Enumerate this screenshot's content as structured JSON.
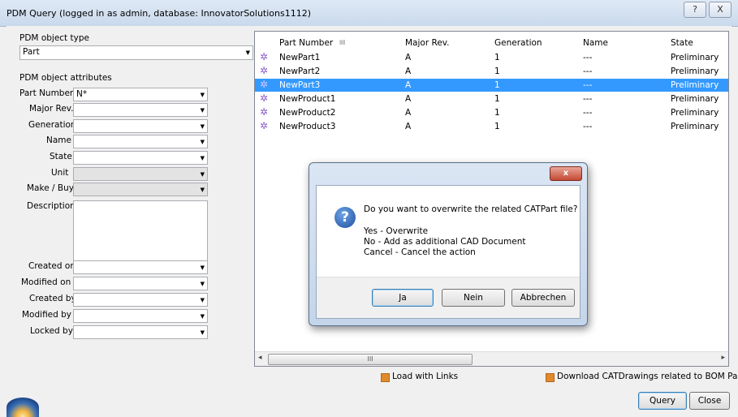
{
  "window": {
    "title": "PDM Query (logged in as admin, database: InnovatorSolutions1112)",
    "help_label": "?",
    "close_label": "X"
  },
  "left": {
    "object_type_label": "PDM object type",
    "object_type_value": "Part",
    "attributes_label": "PDM object attributes",
    "fields": [
      {
        "label": "Part Number",
        "value": "N*"
      },
      {
        "label": "Major Rev.",
        "value": ""
      },
      {
        "label": "Generation",
        "value": ""
      },
      {
        "label": "Name",
        "value": ""
      },
      {
        "label": "State",
        "value": ""
      },
      {
        "label": "Unit",
        "value": ""
      },
      {
        "label": "Make / Buy",
        "value": ""
      },
      {
        "label": "Description",
        "value": ""
      },
      {
        "label": "Created on",
        "value": ""
      },
      {
        "label": "Modified on",
        "value": ""
      },
      {
        "label": "Created by",
        "value": ""
      },
      {
        "label": "Modified by",
        "value": ""
      },
      {
        "label": "Locked by",
        "value": ""
      }
    ]
  },
  "table": {
    "columns": [
      "Part Number",
      "Major Rev.",
      "Generation",
      "Name",
      "State"
    ],
    "rows": [
      [
        "NewPart1",
        "A",
        "1",
        "---",
        "Preliminary"
      ],
      [
        "NewPart2",
        "A",
        "1",
        "---",
        "Preliminary"
      ],
      [
        "NewPart3",
        "A",
        "1",
        "---",
        "Preliminary"
      ],
      [
        "NewProduct1",
        "A",
        "1",
        "---",
        "Preliminary"
      ],
      [
        "NewProduct2",
        "A",
        "1",
        "---",
        "Preliminary"
      ],
      [
        "NewProduct3",
        "A",
        "1",
        "---",
        "Preliminary"
      ]
    ],
    "selected_row": 3,
    "scroll_thumb_label": "III"
  },
  "options": {
    "load_links_label": "Load with Links",
    "download_drawings_label": "Download CATDrawings related to BOM Part"
  },
  "buttons": {
    "query": "Query",
    "close": "Close"
  },
  "dialog": {
    "close_label": "x",
    "question": "Do you want to overwrite the related CATPart file?",
    "line1": "Yes - Overwrite",
    "line2": "No - Add as additional CAD Document",
    "line3": "Cancel - Cancel the action",
    "yes": "Ja",
    "no": "Nein",
    "cancel": "Abbrechen"
  },
  "colors": {
    "selection": "#3399ff",
    "checkbox": "#e08a2b"
  }
}
